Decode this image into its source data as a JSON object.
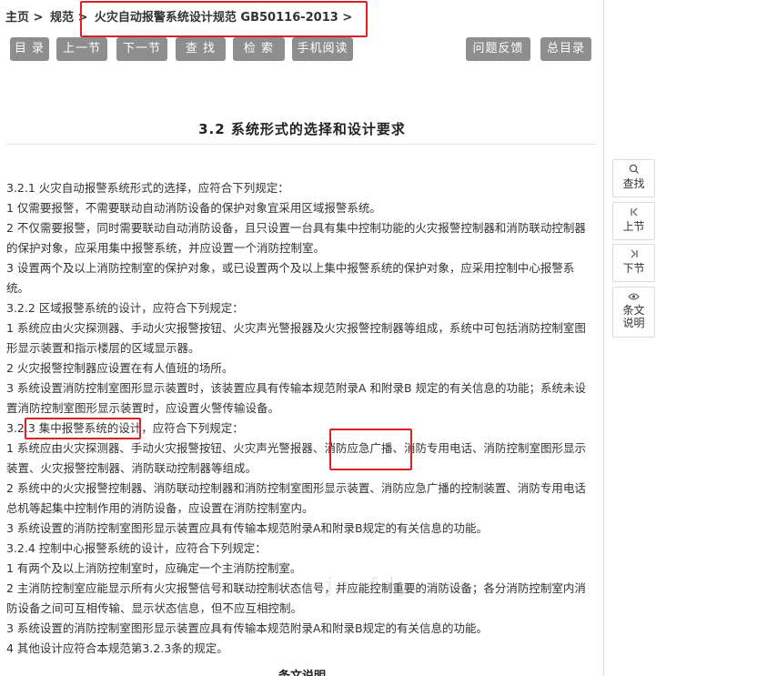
{
  "breadcrumb": {
    "home": "主页 >",
    "spec": "规范 >",
    "current": "火灾自动报警系统设计规范 GB50116-2013 >"
  },
  "toolbar": {
    "toc": "目 录",
    "prev": "上一节",
    "next": "下一节",
    "find": "查 找",
    "search": "检 索",
    "mobile": "手机阅读",
    "feedback": "问题反馈",
    "master_toc": "总目录"
  },
  "title": "3.2 系统形式的选择和设计要求",
  "paragraphs": [
    "3.2.1 火灾自动报警系统形式的选择，应符合下列规定：",
    "  1 仅需要报警，不需要联动自动消防设备的保护对象宜采用区域报警系统。",
    "  2 不仅需要报警，同时需要联动自动消防设备，且只设置一台具有集中控制功能的火灾报警控制器和消防联动控制器的保护对象，应采用集中报警系统，并应设置一个消防控制室。",
    "  3 设置两个及以上消防控制室的保护对象，或已设置两个及以上集中报警系统的保护对象，应采用控制中心报警系统。",
    "3.2.2 区域报警系统的设计，应符合下列规定：",
    "  1 系统应由火灾探测器、手动火灾报警按钮、火灾声光警报器及火灾报警控制器等组成，系统中可包括消防控制室图形显示装置和指示楼层的区域显示器。",
    "  2 火灾报警控制器应设置在有人值班的场所。",
    "  3 系统设置消防控制室图形显示装置时，该装置应具有传输本规范附录A 和附录B 规定的有关信息的功能；系统未设置消防控制室图形显示装置时，应设置火警传输设备。"
  ],
  "p323": {
    "prefix": "3.2.",
    "highlight": "3 集中报警系统的设计",
    "suffix": "，应符合下列规定：",
    "item1_a": "  1 系统应由火灾探测器、手动火灾报警按钮、火灾声光警报器、",
    "item1_hl": "消防应急广播",
    "item1_b": "、消防专用电话、消防控制室图形显示装置、火灾报警控制器、消防联动控制器等组成。"
  },
  "paragraphs2": [
    "  2 系统中的火灾报警控制器、消防联动控制器和消防控制室图形显示装置、消防应急广播的控制装置、消防专用电话总机等起集中控制作用的消防设备，应设置在消防控制室内。",
    "  3 系统设置的消防控制室图形显示装置应具有传输本规范附录A和附录B规定的有关信息的功能。",
    "3.2.4 控制中心报警系统的设计，应符合下列规定：",
    "  1 有两个及以上消防控制室时，应确定一个主消防控制室。",
    "  2 主消防控制室应能显示所有火灾报警信号和联动控制状态信号，并应能控制重要的消防设备；各分消防控制室内消防设备之间可互相传输、显示状态信息，但不应互相控制。",
    "  3 系统设置的消防控制室图形显示装置应具有传输本规范附录A和附录B规定的有关信息的功能。",
    "  4 其他设计应符合本规范第3.2.3条的规定。"
  ],
  "footer_cut": "条文说明",
  "watermark": "jz.fdy.com",
  "sidebar": {
    "find": "查找",
    "prev": "上节",
    "next": "下节",
    "notes_1": "条文",
    "notes_2": "说明"
  },
  "icons": {
    "find": "search-icon",
    "prev": "skip-back-icon",
    "next": "skip-forward-icon",
    "notes": "eye-icon"
  },
  "colors": {
    "button_bg": "#8e8e8e",
    "highlight_border": "#e02020"
  }
}
